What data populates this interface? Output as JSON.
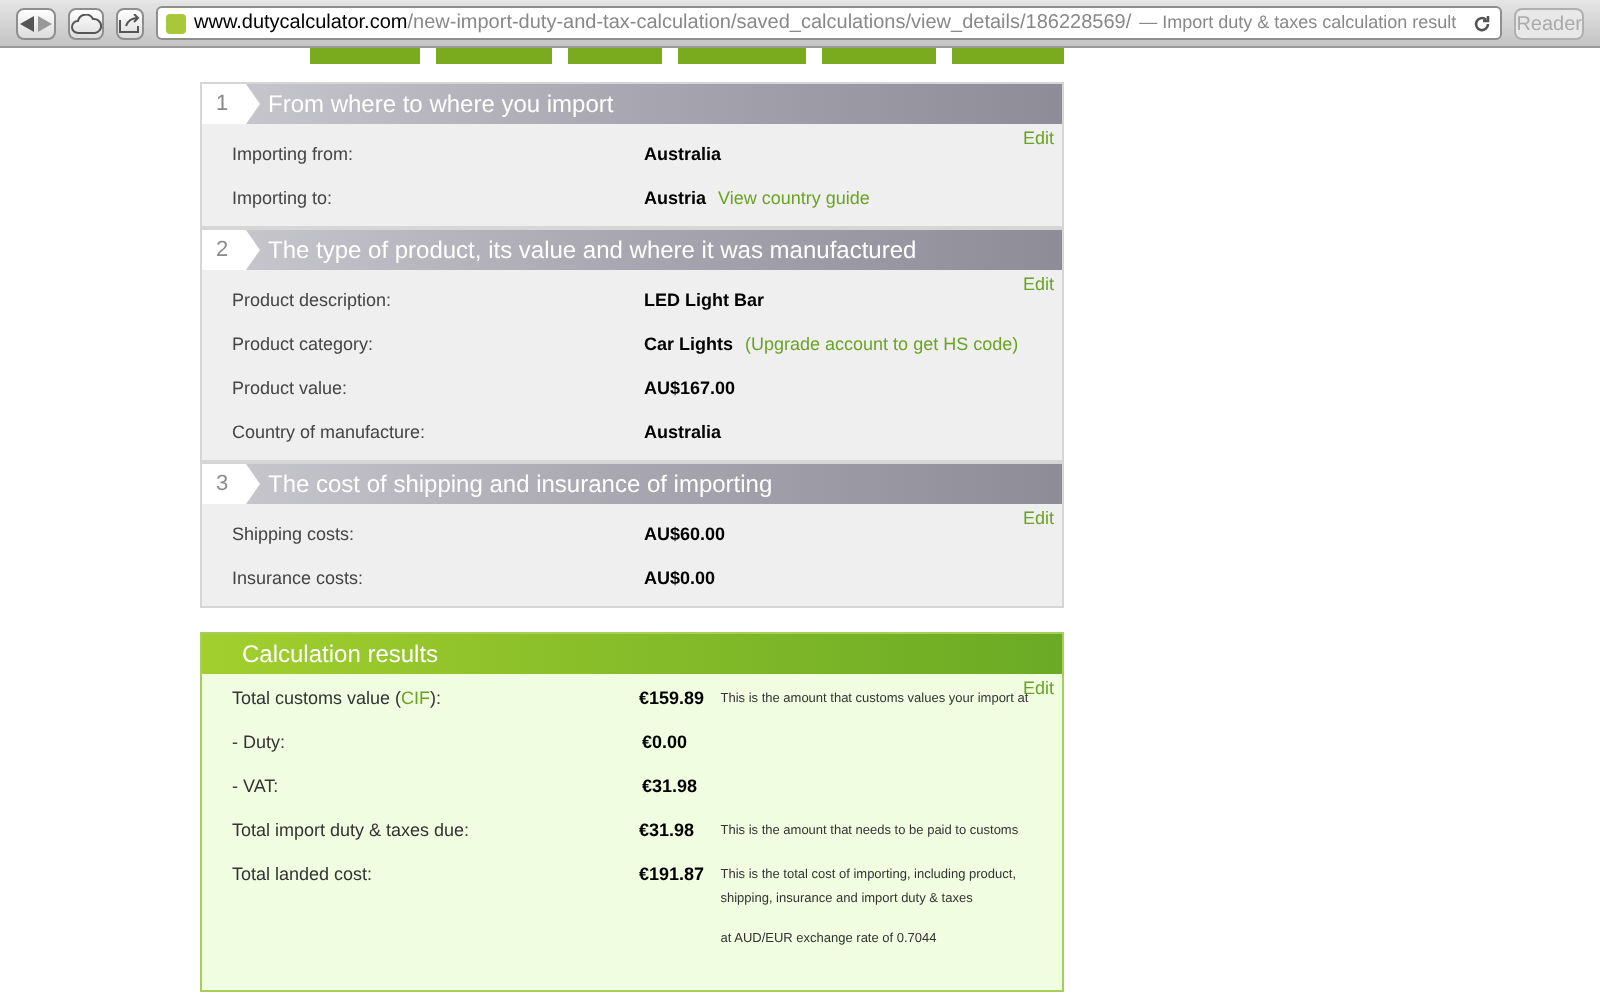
{
  "browser": {
    "url_domain": "www.dutycalculator.com",
    "url_path": "/new-import-duty-and-tax-calculation/saved_calculations/view_details/186228569/",
    "page_title": "— Import duty & taxes calculation result",
    "reader_button": "Reader",
    "reader_disabled": true
  },
  "sections": [
    {
      "number": "1",
      "title": "From where to where you import",
      "edit": "Edit",
      "rows": [
        {
          "label": "Importing from:",
          "value": "Australia"
        },
        {
          "label": "Importing to:",
          "value": "Austria",
          "link": "View country guide"
        }
      ]
    },
    {
      "number": "2",
      "title": "The type of product, its value and where it was manufactured",
      "edit": "Edit",
      "rows": [
        {
          "label": "Product description:",
          "value": "LED Light Bar"
        },
        {
          "label": "Product category:",
          "value": "Car Lights",
          "link": "(Upgrade account to get HS code)"
        },
        {
          "label": "Product value:",
          "value": "AU$167.00"
        },
        {
          "label": "Country of manufacture:",
          "value": "Australia"
        }
      ]
    },
    {
      "number": "3",
      "title": "The cost of shipping and insurance of importing",
      "edit": "Edit",
      "rows": [
        {
          "label": "Shipping costs:",
          "value": "AU$60.00"
        },
        {
          "label": "Insurance costs:",
          "value": "AU$0.00"
        }
      ]
    }
  ],
  "results": {
    "title": "Calculation results",
    "edit": "Edit",
    "rows": [
      {
        "label": "Total customs value (",
        "label_link": "CIF",
        "label_end": "):",
        "value": "€159.89",
        "notes": [
          "This is the amount that customs values your import at"
        ]
      },
      {
        "label": "- Duty:",
        "value": "€0.00"
      },
      {
        "label": "- VAT:",
        "value": "€31.98"
      },
      {
        "label": "Total import duty & taxes due:",
        "value": "€31.98",
        "notes": [
          "This is the amount that needs to be paid to customs"
        ]
      },
      {
        "label": "Total landed cost:",
        "value": "€191.87",
        "notes": [
          "This is the total cost of importing, including product, shipping, insurance and import duty & taxes",
          "at AUD/EUR exchange rate of 0.7044"
        ]
      }
    ]
  }
}
